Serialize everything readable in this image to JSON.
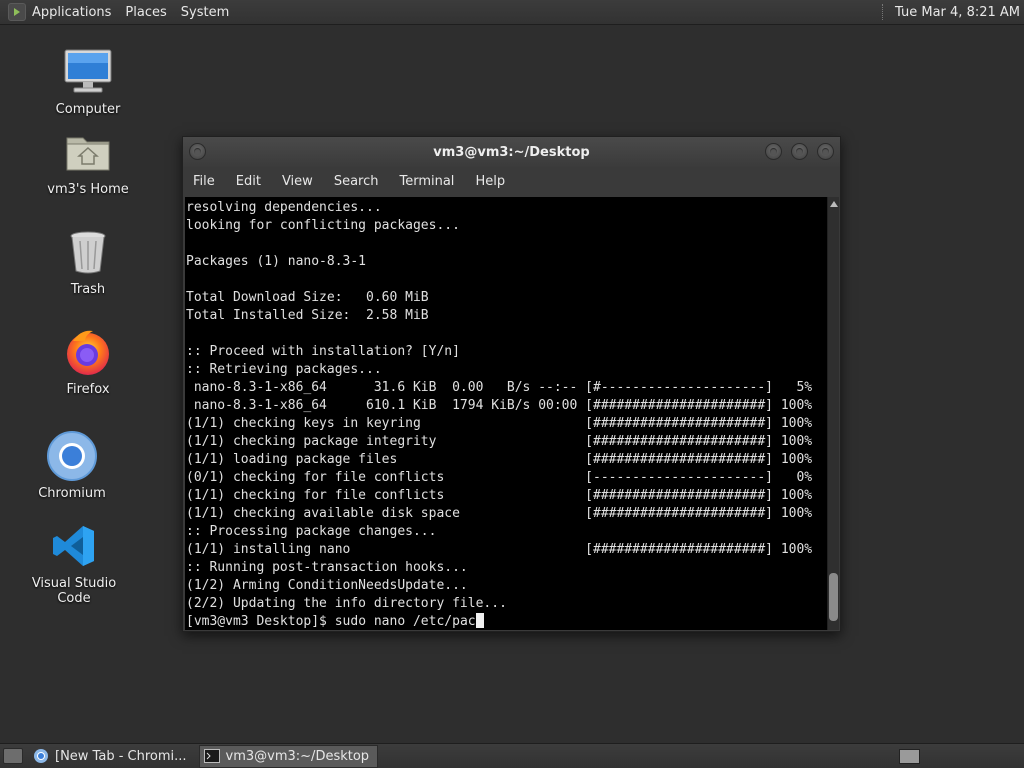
{
  "top_panel": {
    "menus": [
      "Applications",
      "Places",
      "System"
    ],
    "clock": "Tue Mar  4,  8:21 AM"
  },
  "desktop_icons": [
    {
      "label": "Computer",
      "icon": "computer-icon"
    },
    {
      "label": "vm3's Home",
      "icon": "home-folder-icon"
    },
    {
      "label": "Trash",
      "icon": "trash-icon"
    },
    {
      "label": "Firefox",
      "icon": "firefox-icon"
    },
    {
      "label": "Chromium",
      "icon": "chromium-icon"
    },
    {
      "label": "Visual Studio Code",
      "icon": "vscode-icon"
    }
  ],
  "terminal_window": {
    "title": "vm3@vm3:~/Desktop",
    "menu": [
      "File",
      "Edit",
      "View",
      "Search",
      "Terminal",
      "Help"
    ],
    "lines": [
      "resolving dependencies...",
      "looking for conflicting packages...",
      "",
      "Packages (1) nano-8.3-1",
      "",
      "Total Download Size:   0.60 MiB",
      "Total Installed Size:  2.58 MiB",
      "",
      ":: Proceed with installation? [Y/n]",
      ":: Retrieving packages...",
      " nano-8.3-1-x86_64      31.6 KiB  0.00   B/s --:-- [#---------------------]   5%",
      " nano-8.3-1-x86_64     610.1 KiB  1794 KiB/s 00:00 [######################] 100%",
      "(1/1) checking keys in keyring                     [######################] 100%",
      "(1/1) checking package integrity                   [######################] 100%",
      "(1/1) loading package files                        [######################] 100%",
      "(0/1) checking for file conflicts                  [----------------------]   0%",
      "(1/1) checking for file conflicts                  [######################] 100%",
      "(1/1) checking available disk space                [######################] 100%",
      ":: Processing package changes...",
      "(1/1) installing nano                              [######################] 100%",
      ":: Running post-transaction hooks...",
      "(1/2) Arming ConditionNeedsUpdate...",
      "(2/2) Updating the info directory file..."
    ],
    "prompt": "[vm3@vm3 Desktop]$ ",
    "command": "sudo nano /etc/pac"
  },
  "taskbar": {
    "tasks": [
      {
        "label": "[New Tab - Chromi...",
        "icon": "chromium-icon",
        "active": false
      },
      {
        "label": "vm3@vm3:~/Desktop",
        "icon": "terminal-icon",
        "active": true
      }
    ]
  }
}
